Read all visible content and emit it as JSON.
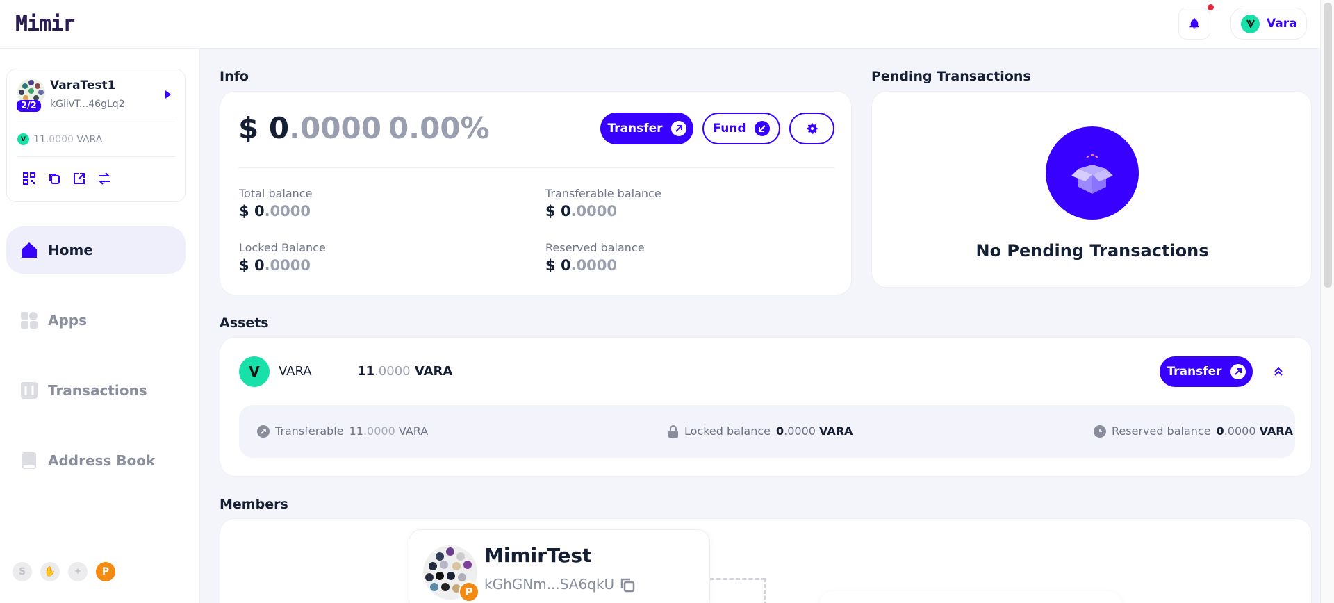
{
  "header": {
    "logo": "Mimir",
    "network": "Vara"
  },
  "sidebar": {
    "account": {
      "name": "VaraTest1",
      "address": "kGiivT...46gLq2",
      "threshold_badge": "2/2",
      "balance_int": "11",
      "balance_dec": ".0000",
      "balance_unit": "VARA"
    },
    "account_actions": [
      "qr-code-icon",
      "copy-icon",
      "external-link-icon",
      "transfer-icon"
    ],
    "nav": [
      {
        "label": "Home",
        "icon": "home-icon",
        "active": true
      },
      {
        "label": "Apps",
        "icon": "apps-icon",
        "active": false
      },
      {
        "label": "Transactions",
        "icon": "transactions-icon",
        "active": false
      },
      {
        "label": "Address Book",
        "icon": "address-book-icon",
        "active": false
      }
    ],
    "footer_icons": [
      "subscan-icon",
      "hand-icon",
      "bird-icon",
      "polkadot-icon"
    ]
  },
  "info": {
    "section_title": "Info",
    "total_symbol": "$",
    "total_int": "0",
    "total_dec": ".0000",
    "change_pct": "0.00%",
    "transfer_label": "Transfer",
    "fund_label": "Fund",
    "balances": {
      "total_label": "Total balance",
      "transferable_label": "Transferable balance",
      "locked_label": "Locked Balance",
      "reserved_label": "Reserved balance",
      "symbol": "$",
      "int": "0",
      "dec": ".0000"
    }
  },
  "pending": {
    "section_title": "Pending Transactions",
    "empty_text": "No Pending Transactions"
  },
  "assets": {
    "section_title": "Assets",
    "token": "VARA",
    "amount_int": "11",
    "amount_dec": ".0000",
    "amount_unit": "VARA",
    "transfer_label": "Transfer",
    "transferable_label": "Transferable",
    "transferable_int": "11",
    "transferable_dec": ".0000",
    "locked_label": "Locked balance",
    "locked_int": "0",
    "locked_dec": ".0000",
    "reserved_label": "Reserved balance",
    "reserved_int": "0",
    "reserved_dec": ".0000",
    "unit": "VARA"
  },
  "members": {
    "section_title": "Members",
    "member_name": "MimirTest",
    "member_address": "kGhGNm...SA6qkU"
  },
  "colors": {
    "accent": "#3700ff",
    "vara": "#17e0a8",
    "notification": "#e8283e"
  }
}
